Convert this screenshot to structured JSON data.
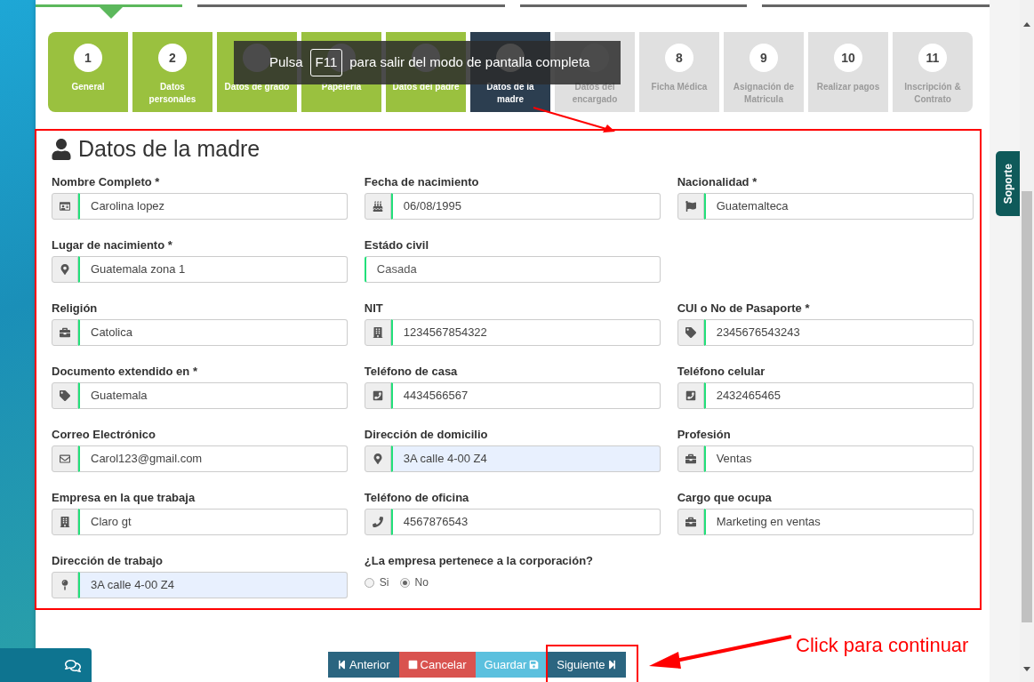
{
  "progress_tabs": [
    {
      "selected": true
    },
    {
      "selected": false
    },
    {
      "selected": false
    },
    {
      "selected": false
    }
  ],
  "steps": [
    {
      "number": "1",
      "label": "General",
      "completed": true,
      "selected": false
    },
    {
      "number": "2",
      "label": "Datos personales",
      "completed": true,
      "selected": false
    },
    {
      "label": "Datos de grado",
      "completed": true,
      "selected": false
    },
    {
      "label": "Papelería",
      "completed": true,
      "selected": false
    },
    {
      "label": "Datos del padre",
      "completed": true,
      "selected": false
    },
    {
      "label": "Datos de la madre",
      "completed": false,
      "selected": true
    },
    {
      "label": "Datos del encargado",
      "completed": false,
      "selected": false
    },
    {
      "number": "8",
      "label": "Ficha Médica",
      "completed": false,
      "selected": false
    },
    {
      "number": "9",
      "label": "Asignación de Matricula",
      "completed": false,
      "selected": false
    },
    {
      "number": "10",
      "label": "Realizar pagos",
      "completed": false,
      "selected": false
    },
    {
      "number": "11",
      "label": "Inscripción & Contrato",
      "completed": false,
      "selected": false
    }
  ],
  "fullscreen_notice": {
    "before": "Pulsa",
    "key": "F11",
    "after": "para salir del modo de pantalla completa"
  },
  "section": {
    "title": "Datos de la madre",
    "rows": [
      [
        {
          "kind": "input",
          "label": "Nombre Completo *",
          "value": "Carolina lopez",
          "autofilled": false
        },
        {
          "kind": "input",
          "label": "Fecha de nacimiento",
          "value": "06/08/1995",
          "autofilled": false
        },
        {
          "kind": "input",
          "label": "Nacionalidad *",
          "value": "Guatemalteca",
          "autofilled": false
        }
      ],
      [
        {
          "kind": "input",
          "label": "Lugar de nacimiento *",
          "value": "Guatemala zona 1",
          "autofilled": false
        },
        {
          "kind": "select",
          "label": "Estádo civil",
          "value": "Casada"
        }
      ],
      [
        {
          "kind": "input",
          "label": "Religión",
          "value": "Catolica",
          "autofilled": false
        },
        {
          "kind": "input",
          "label": "NIT",
          "value": "1234567854322",
          "autofilled": false
        },
        {
          "kind": "input",
          "label": "CUI o No de Pasaporte *",
          "value": "2345676543243",
          "autofilled": false
        }
      ],
      [
        {
          "kind": "input",
          "label": "Documento extendido en *",
          "value": "Guatemala",
          "autofilled": false
        },
        {
          "kind": "input",
          "label": "Teléfono de casa",
          "value": "4434566567",
          "autofilled": false
        },
        {
          "kind": "input",
          "label": "Teléfono celular",
          "value": "2432465465",
          "autofilled": false
        }
      ],
      [
        {
          "kind": "input",
          "label": "Correo Electrónico",
          "value": "Carol123@gmail.com",
          "autofilled": false
        },
        {
          "kind": "input",
          "label": "Dirección de domicilio",
          "value": "3A calle 4-00 Z4",
          "autofilled": true
        },
        {
          "kind": "input",
          "label": "Profesión",
          "value": "Ventas",
          "autofilled": false
        }
      ],
      [
        {
          "kind": "input",
          "label": "Empresa en la que trabaja",
          "value": "Claro gt",
          "autofilled": false
        },
        {
          "kind": "input",
          "label": "Teléfono de oficina",
          "value": "4567876543",
          "autofilled": false
        },
        {
          "kind": "input",
          "label": "Cargo que ocupa",
          "value": "Marketing en ventas",
          "autofilled": false
        }
      ],
      [
        {
          "kind": "input",
          "label": "Dirección de trabajo",
          "value": "3A calle 4-00 Z4",
          "autofilled": true
        },
        {
          "kind": "radio",
          "label": "¿La empresa pertenece a la corporación?",
          "options": [
            {
              "label": "Si",
              "selected": false
            },
            {
              "label": "No",
              "selected": true
            }
          ]
        }
      ]
    ]
  },
  "buttons": [
    {
      "label": "Anterior",
      "kind": "prev"
    },
    {
      "label": "Cancelar",
      "kind": "cancel"
    },
    {
      "label": "Guardar",
      "kind": "save"
    },
    {
      "label": "Siguiente",
      "kind": "next"
    }
  ],
  "annotation": {
    "text": "Click para continuar"
  },
  "support_tab": {
    "label": "Soporte"
  }
}
